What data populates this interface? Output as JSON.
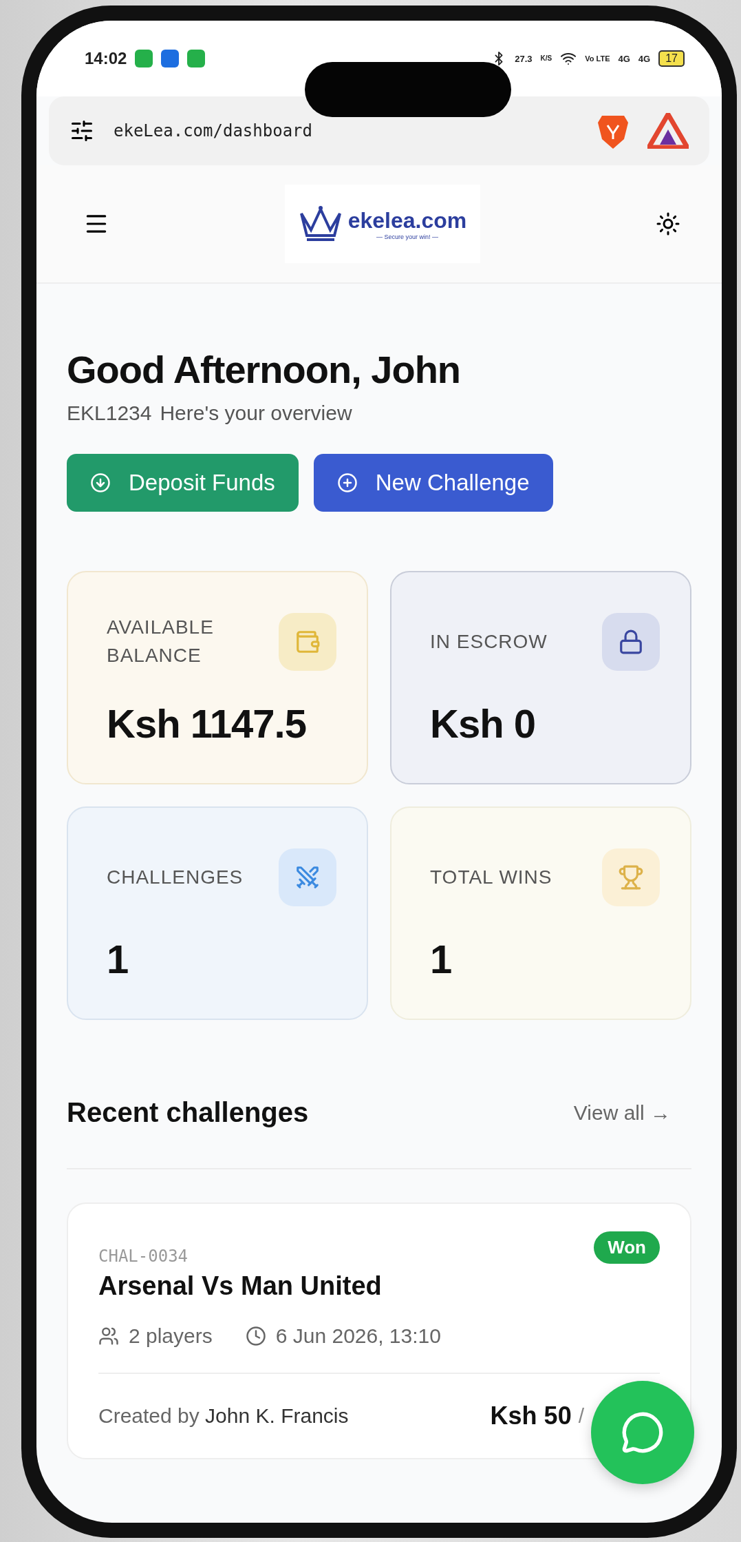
{
  "status_bar": {
    "time": "14:02",
    "network_speed": "27.3",
    "speed_unit": "K/S",
    "volte": "Vo LTE",
    "signal_1": "4G",
    "signal_2": "4G",
    "battery": "17"
  },
  "address_bar": {
    "url": "ekeLea.com/dashboard"
  },
  "header": {
    "logo_text": "ekelea.com",
    "logo_tagline": "— Secure your win! —"
  },
  "greeting": {
    "title": "Good Afternoon, John",
    "user_id": "EKL1234",
    "subtitle": "Here's your overview"
  },
  "actions": [
    {
      "label": "Deposit Funds",
      "kind": "deposit"
    },
    {
      "label": "New Challenge",
      "kind": "challenge"
    }
  ],
  "stats": [
    {
      "label": "AVAILABLE BALANCE",
      "value": "Ksh 1147.5",
      "kind": "wallet"
    },
    {
      "label": "IN ESCROW",
      "value": "Ksh 0",
      "kind": "lock"
    },
    {
      "label": "CHALLENGES",
      "value": "1",
      "kind": "swords"
    },
    {
      "label": "TOTAL WINS",
      "value": "1",
      "kind": "trophy"
    }
  ],
  "recent": {
    "title": "Recent challenges",
    "link": "View all →",
    "items": [
      {
        "code": "CHAL-0034",
        "title": "Arsenal Vs Man United",
        "status": "Won",
        "players": "2 players",
        "date": "6 Jun 2026, 13:10",
        "created_label": "Created by",
        "creator": "John K. Francis",
        "amount": "Ksh 50",
        "amount_suffix": "/"
      }
    ]
  }
}
